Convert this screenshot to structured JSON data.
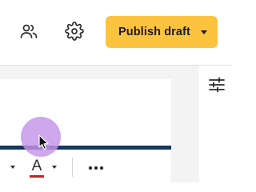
{
  "header": {
    "share_icon": "users-icon",
    "settings_icon": "gear-icon",
    "publish_button": {
      "label": "Publish draft",
      "color": "#fcc33f"
    }
  },
  "sidebar": {
    "icon": "sliders-icon"
  },
  "format_toolbar": {
    "text_color_glyph": "A",
    "text_color_swatch": "#d01c22",
    "more_icon": "more-horizontal-icon"
  },
  "colors": {
    "accent_line": "#16375e",
    "click_indicator": "#c494e8"
  }
}
